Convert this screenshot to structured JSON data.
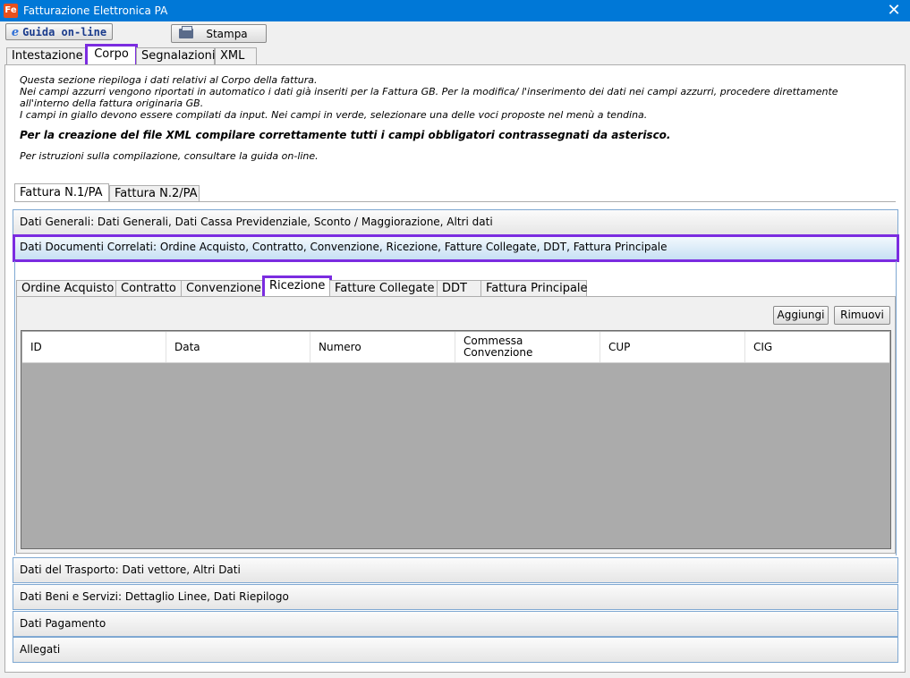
{
  "window": {
    "title": "Fatturazione Elettronica PA",
    "app_icon": "Fe",
    "close": "✕"
  },
  "toolbar": {
    "help_icon": "e",
    "help_label": "Guida on-line",
    "print_label": "Stampa"
  },
  "main_tabs": [
    "Intestazione",
    "Corpo",
    "Segnalazioni",
    "XML"
  ],
  "info": {
    "line1": "Questa sezione riepiloga i dati relativi al Corpo della fattura.",
    "line2": "Nei campi azzurri vengono riportati in automatico i dati già inseriti per la Fattura GB. Per la modifica/ l'inserimento dei dati nei campi azzurri, procedere direttamente all'interno della fattura originaria GB.",
    "line3": "I campi in giallo devono essere compilati da input. Nei campi in verde, selezionare una delle voci proposte nel menù a tendina.",
    "bold": "Per la creazione del file XML compilare correttamente tutti i campi obbligatori contrassegnati da asterisco.",
    "guide": "Per istruzioni sulla compilazione, consultare la guida on-line."
  },
  "invoice_tabs": [
    "Fattura N.1/PA",
    "Fattura N.2/PA"
  ],
  "sections": {
    "generali": "Dati Generali: Dati Generali, Dati Cassa Previdenziale, Sconto / Maggiorazione, Altri dati",
    "correlati": "Dati Documenti Correlati: Ordine Acquisto, Contratto, Convenzione, Ricezione, Fatture Collegate, DDT, Fattura Principale",
    "trasporto": "Dati del Trasporto: Dati vettore, Altri Dati",
    "beni": "Dati Beni e Servizi: Dettaglio Linee, Dati Riepilogo",
    "pagamento": "Dati Pagamento",
    "allegati": "Allegati"
  },
  "doc_tabs": [
    "Ordine Acquisto",
    "Contratto",
    "Convenzione",
    "Ricezione",
    "Fatture Collegate",
    "DDT",
    "Fattura Principale"
  ],
  "buttons": {
    "add": "Aggiungi",
    "remove": "Rimuovi"
  },
  "grid": {
    "columns": [
      "ID",
      "Data",
      "Numero",
      "Commessa\nConvenzione",
      "CUP",
      "CIG"
    ],
    "rows": []
  }
}
